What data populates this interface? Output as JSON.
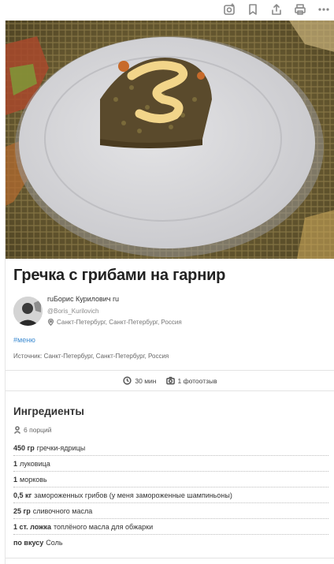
{
  "toolbar": {
    "icons": [
      "story-icon",
      "bookmark-icon",
      "share-icon",
      "print-icon",
      "more-icon"
    ]
  },
  "recipe": {
    "title": "Гречка с грибами на гарнир",
    "author": {
      "name": "ruБорис Курилович ru",
      "handle": "@Boris_Kurilovich",
      "location": "Санкт-Петербург, Санкт-Петербург, Россия"
    },
    "tag": "#меню",
    "source": "Источник: Санкт-Петербург, Санкт-Петербург, Россия",
    "stats": {
      "time": "30 мин",
      "photo_reviews": "1 фотоотзыв"
    }
  },
  "ingredients": {
    "title": "Ингредиенты",
    "portions": "6 порций",
    "items": [
      {
        "amount": "450 гр",
        "name": "гречки-ядрицы"
      },
      {
        "amount": "1",
        "name": "луковица"
      },
      {
        "amount": "1",
        "name": "морковь"
      },
      {
        "amount": "0,5 кг",
        "name": "замороженных грибов (у меня замороженные шампиньоны)"
      },
      {
        "amount": "25 гр",
        "name": "сливочного масла"
      },
      {
        "amount": "1 ст. ложка",
        "name": "топлёного масла для обжарки"
      },
      {
        "amount": "по вкусу",
        "name": "Соль"
      }
    ]
  },
  "colors": {
    "link": "#3d8bd1",
    "plate": "#d9d9dc",
    "mayo": "#f2d58a"
  }
}
